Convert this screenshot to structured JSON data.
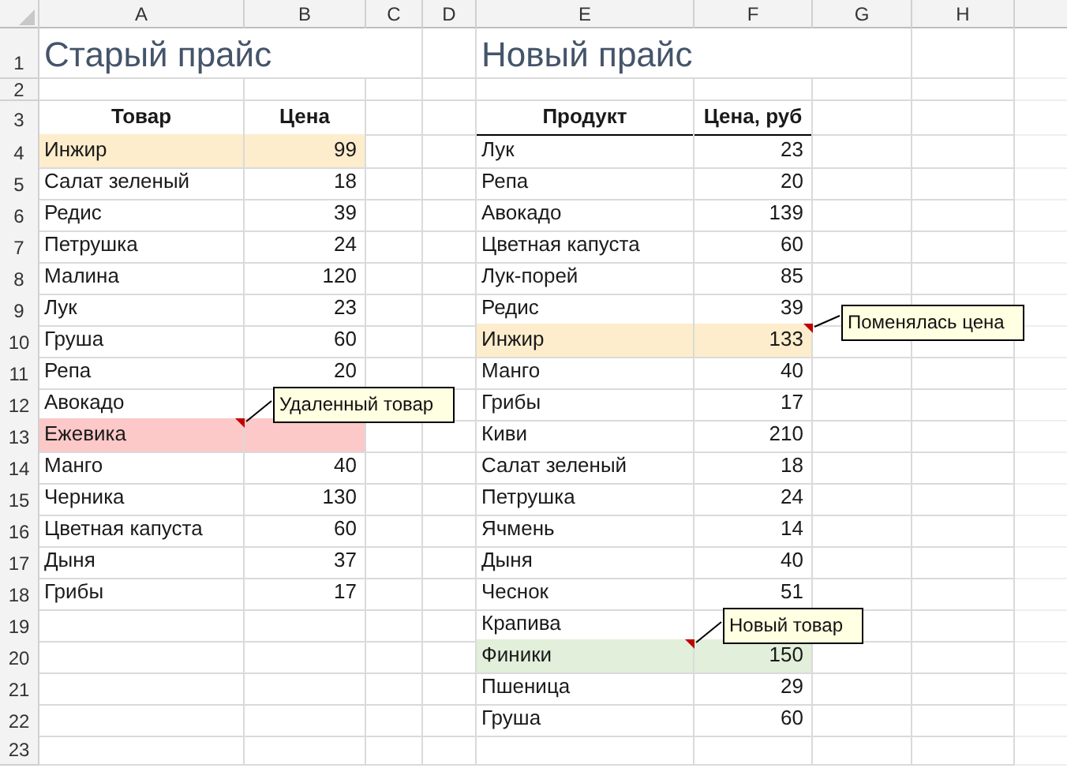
{
  "columns": [
    "A",
    "B",
    "C",
    "D",
    "E",
    "F",
    "G",
    "H"
  ],
  "row_numbers": [
    "1",
    "2",
    "3",
    "4",
    "5",
    "6",
    "7",
    "8",
    "9",
    "10",
    "11",
    "12",
    "13",
    "14",
    "15",
    "16",
    "17",
    "18",
    "19",
    "20",
    "21",
    "22",
    "23"
  ],
  "old_price": {
    "title": "Старый прайс",
    "headers": [
      "Товар",
      "Цена"
    ],
    "rows": [
      {
        "product": "Инжир",
        "price": "99",
        "color": "#fdedcc"
      },
      {
        "product": "Салат зеленый",
        "price": "18"
      },
      {
        "product": "Редис",
        "price": "39"
      },
      {
        "product": "Петрушка",
        "price": "24"
      },
      {
        "product": "Малина",
        "price": "120"
      },
      {
        "product": "Лук",
        "price": "23"
      },
      {
        "product": "Груша",
        "price": "60"
      },
      {
        "product": "Репа",
        "price": "20"
      },
      {
        "product": "Авокадо"
      },
      {
        "product": "Ежевика",
        "color": "#fcc8c8",
        "product_comment": "Удаленный товар"
      },
      {
        "product": "Манго",
        "price": "40"
      },
      {
        "product": "Черника",
        "price": "130"
      },
      {
        "product": "Цветная капуста",
        "price": "60"
      },
      {
        "product": "Дыня",
        "price": "37"
      },
      {
        "product": "Грибы",
        "price": "17"
      }
    ]
  },
  "new_price": {
    "title": "Новый прайс",
    "headers": [
      "Продукт",
      "Цена, руб"
    ],
    "rows": [
      {
        "product": "Лук",
        "price": "23"
      },
      {
        "product": "Репа",
        "price": "20"
      },
      {
        "product": "Авокадо",
        "price": "139"
      },
      {
        "product": "Цветная капуста",
        "price": "60"
      },
      {
        "product": "Лук-порей",
        "price": "85"
      },
      {
        "product": "Редис",
        "price": "39"
      },
      {
        "product": "Инжир",
        "price": "133",
        "color": "#fdedcc",
        "price_comment": "Поменялась цена"
      },
      {
        "product": "Манго",
        "price": "40"
      },
      {
        "product": "Грибы",
        "price": "17"
      },
      {
        "product": "Киви",
        "price": "210"
      },
      {
        "product": "Салат зеленый",
        "price": "18"
      },
      {
        "product": "Петрушка",
        "price": "24"
      },
      {
        "product": "Ячмень",
        "price": "14"
      },
      {
        "product": "Дыня",
        "price": "40"
      },
      {
        "product": "Чеснок",
        "price": "51"
      },
      {
        "product": "Крапива"
      },
      {
        "product": "Финики",
        "price": "150",
        "color": "#e2efda",
        "product_comment": "Новый товар"
      },
      {
        "product": "Пшеница",
        "price": "29"
      },
      {
        "product": "Груша",
        "price": "60"
      }
    ]
  }
}
